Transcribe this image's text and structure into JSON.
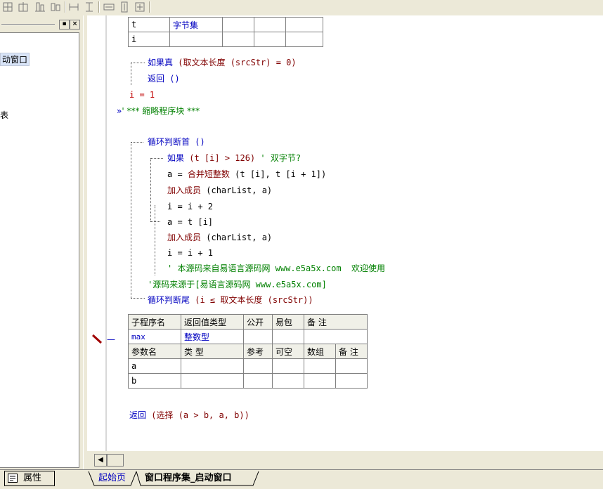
{
  "left_panel": {
    "tree_items": [
      "动窗口",
      "表"
    ]
  },
  "editor": {
    "var_table": [
      [
        "t",
        "字节集",
        "",
        "",
        ""
      ],
      [
        "i",
        "",
        "",
        "",
        ""
      ]
    ],
    "lines": {
      "if_true": "如果真",
      "if_true_args": " (取文本长度 (srcStr) = 0)",
      "return_empty": "返回 ()",
      "assign_i": "i = 1",
      "collapsed_marker": "»",
      "collapsed": "' *** 缩略程序块 ***",
      "loop_head": "循环判断首 ()",
      "if_stmt": "如果",
      "if_args": " (t [i] > 126)",
      "if_comment": " ' 双字节?",
      "a_eq": "a = ",
      "merge_fn": "合并短整数",
      "merge_args": " (t [i], t [i + 1])",
      "add_member1": "加入成员",
      "add_member1_args": " (charList, a)",
      "i_plus2": "i = i + 2",
      "a_t": "a = t [i]",
      "add_member2": "加入成员",
      "add_member2_args": " (charList, a)",
      "i_plus1": "i = i + 1",
      "comment1": "' 本源码来自易语言源码网 www.e5a5x.com  欢迎使用",
      "comment2": "'源码来源于[易语言源码网 www.e5a5x.com]",
      "loop_tail": "循环判断尾",
      "loop_tail_args": " (i ≤ 取文本长度 (srcStr))",
      "return_choose": "返回",
      "return_choose_args": " (选择 (a > b, a, b))"
    },
    "sub_table": {
      "header": [
        "子程序名",
        "返回值类型",
        "公开",
        "易包",
        "备 注"
      ],
      "row": [
        "max",
        "整数型",
        "",
        "",
        ""
      ],
      "param_header": [
        "参数名",
        "类 型",
        "参考",
        "可空",
        "数组",
        "备 注"
      ],
      "params": [
        [
          "a",
          "",
          "",
          "",
          "",
          ""
        ],
        [
          "b",
          "",
          "",
          "",
          "",
          ""
        ]
      ]
    },
    "marker": "—"
  },
  "bottom": {
    "properties_label": "属性",
    "tabs": [
      "起始页",
      "窗口程序集_启动窗口"
    ]
  },
  "colors": {
    "keyword": "#0000c0",
    "function": "#800000",
    "number": "#c00000",
    "comment": "#008000"
  }
}
